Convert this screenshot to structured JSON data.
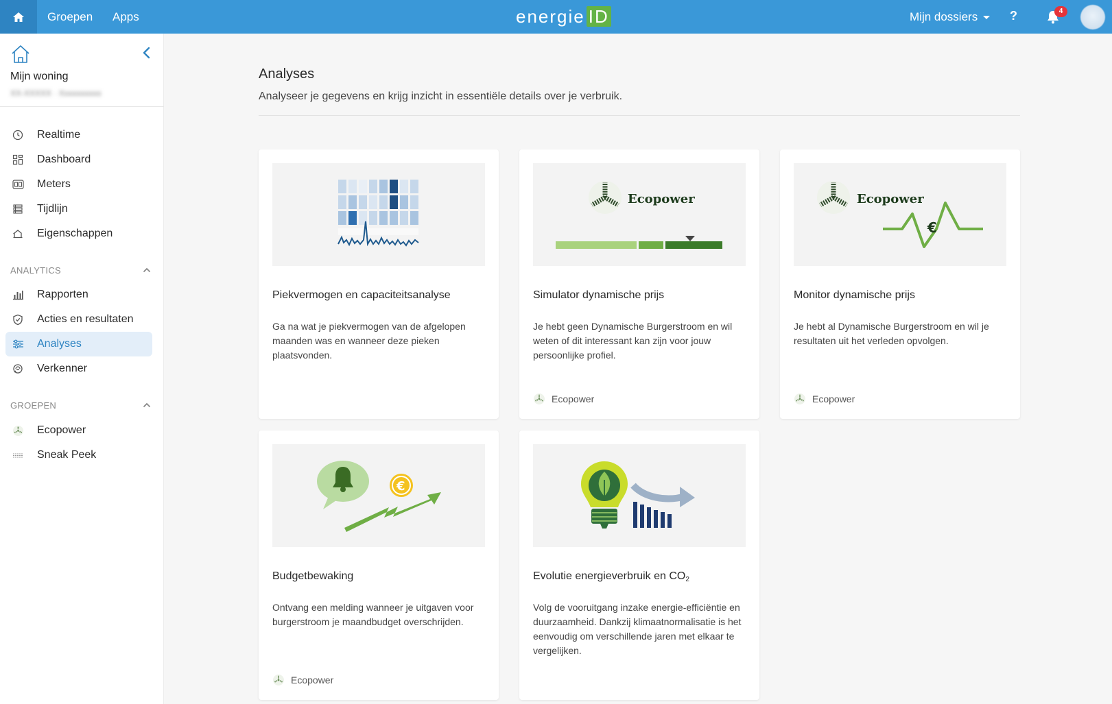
{
  "topbar": {
    "nav": [
      "Groepen",
      "Apps"
    ],
    "logo_text": "energie",
    "logo_box": "ID",
    "dossiers_label": "Mijn dossiers",
    "help_label": "?",
    "notification_count": "4",
    "colors": {
      "bar": "#3a98d8",
      "home_bg": "#2e84c2",
      "badge": "#e5343a",
      "logo_green": "#63b346"
    }
  },
  "sidebar": {
    "home_title": "Mijn woning",
    "home_subtitle": "XX-XXXXX · Xxxxxxxxxx",
    "items": [
      {
        "label": "Realtime",
        "icon": "clock-icon"
      },
      {
        "label": "Dashboard",
        "icon": "dashboard-icon"
      },
      {
        "label": "Meters",
        "icon": "meters-icon"
      },
      {
        "label": "Tijdlijn",
        "icon": "timeline-icon"
      },
      {
        "label": "Eigenschappen",
        "icon": "house-outline-icon"
      }
    ],
    "analytics_header": "ANALYTICS",
    "analytics_items": [
      {
        "label": "Rapporten",
        "icon": "bar-chart-icon"
      },
      {
        "label": "Acties en resultaten",
        "icon": "shield-check-icon"
      },
      {
        "label": "Analyses",
        "icon": "sliders-icon",
        "active": true
      },
      {
        "label": "Verkenner",
        "icon": "explorer-icon"
      }
    ],
    "groups_header": "GROEPEN",
    "group_items": [
      {
        "label": "Ecopower",
        "icon": "ecopower-logo-icon"
      },
      {
        "label": "Sneak Peek",
        "icon": "sneak-peek-icon"
      }
    ],
    "active_color": "#2e84c2",
    "active_bg": "#e3eef9"
  },
  "main": {
    "title": "Analyses",
    "subtitle": "Analyseer je gegevens en krijg inzicht in essentiële details over je verbruik.",
    "cards": [
      {
        "title": "Piekvermogen en capaciteitsanalyse",
        "description": "Ga na wat je piekvermogen van de afgelopen maanden was en wanneer deze pieken plaatsvonden.",
        "footer": ""
      },
      {
        "title": "Simulator dynamische prijs",
        "description": "Je hebt geen Dynamische Burgerstroom en wil weten of dit interessant kan zijn voor jouw persoonlijke profiel.",
        "footer": "Ecopower",
        "thumb_brand": "Ecopower"
      },
      {
        "title": "Monitor dynamische prijs",
        "description": "Je hebt al Dynamische Burgerstroom en wil je resultaten uit het verleden opvolgen.",
        "footer": "Ecopower",
        "thumb_brand": "Ecopower"
      },
      {
        "title": "Budgetbewaking",
        "description": "Ontvang een melding wanneer je uitgaven voor burgerstroom je maandbudget overschrijden.",
        "footer": "Ecopower"
      },
      {
        "title_main": "Evolutie energieverbruik en CO",
        "title_sub": "2",
        "description": "Volg de vooruitgang inzake energie-efficiëntie en duurzaamheid. Dankzij klimaatnormalisatie is het eenvoudig om verschillende jaren met elkaar te vergelijken.",
        "footer": ""
      }
    ]
  }
}
